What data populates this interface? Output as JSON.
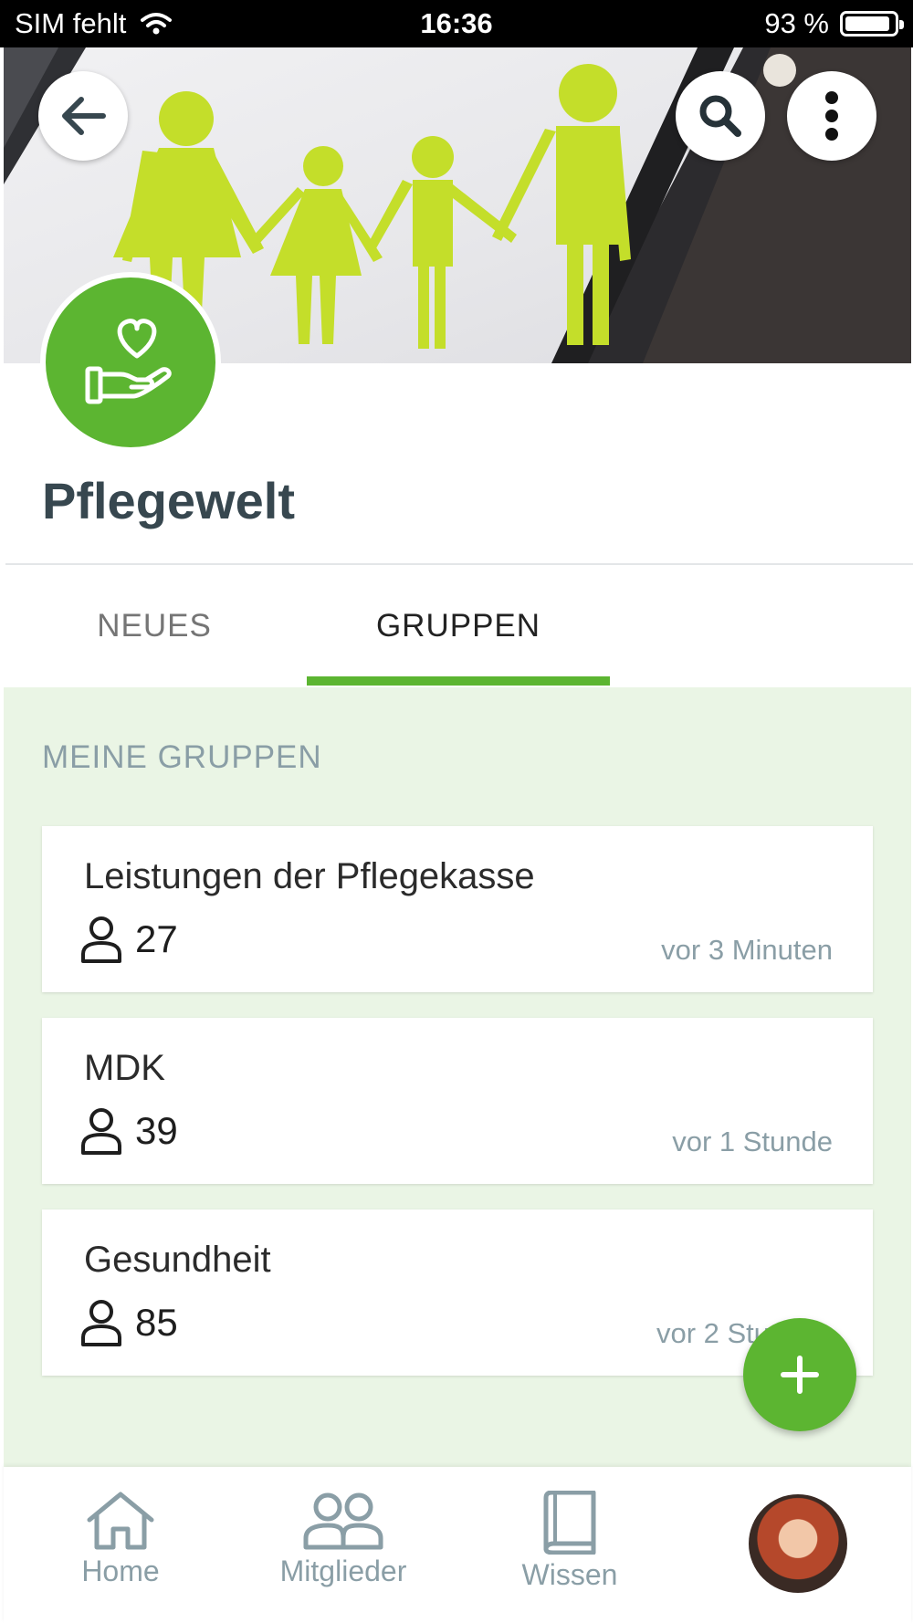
{
  "status_bar": {
    "carrier": "SIM fehlt",
    "time": "16:36",
    "battery": "93 %",
    "battery_level": 0.93
  },
  "header": {
    "back_icon": "arrow-left-icon",
    "search_icon": "search-icon",
    "more_icon": "more-vertical-icon",
    "logo_icon": "heart-hand-icon"
  },
  "page": {
    "title": "Pflegewelt"
  },
  "tabs": [
    {
      "label": "NEUES",
      "active": false
    },
    {
      "label": "GRUPPEN",
      "active": true
    }
  ],
  "section": {
    "heading": "MEINE GRUPPEN"
  },
  "groups": [
    {
      "name": "Leistungen der Pflegekasse",
      "members": "27",
      "updated": "vor 3 Minuten"
    },
    {
      "name": "MDK",
      "members": "39",
      "updated": "vor 1 Stunde"
    },
    {
      "name": "Gesundheit",
      "members": "85",
      "updated": "vor 2 Stunden"
    }
  ],
  "fab": {
    "icon": "plus-icon"
  },
  "nav": {
    "home": "Home",
    "mitglieder": "Mitglieder",
    "wissen": "Wissen"
  },
  "colors": {
    "accent": "#5cb531",
    "background_light": "#eaf5e5",
    "muted_text": "#8a9ea6",
    "title_text": "#37474f"
  }
}
